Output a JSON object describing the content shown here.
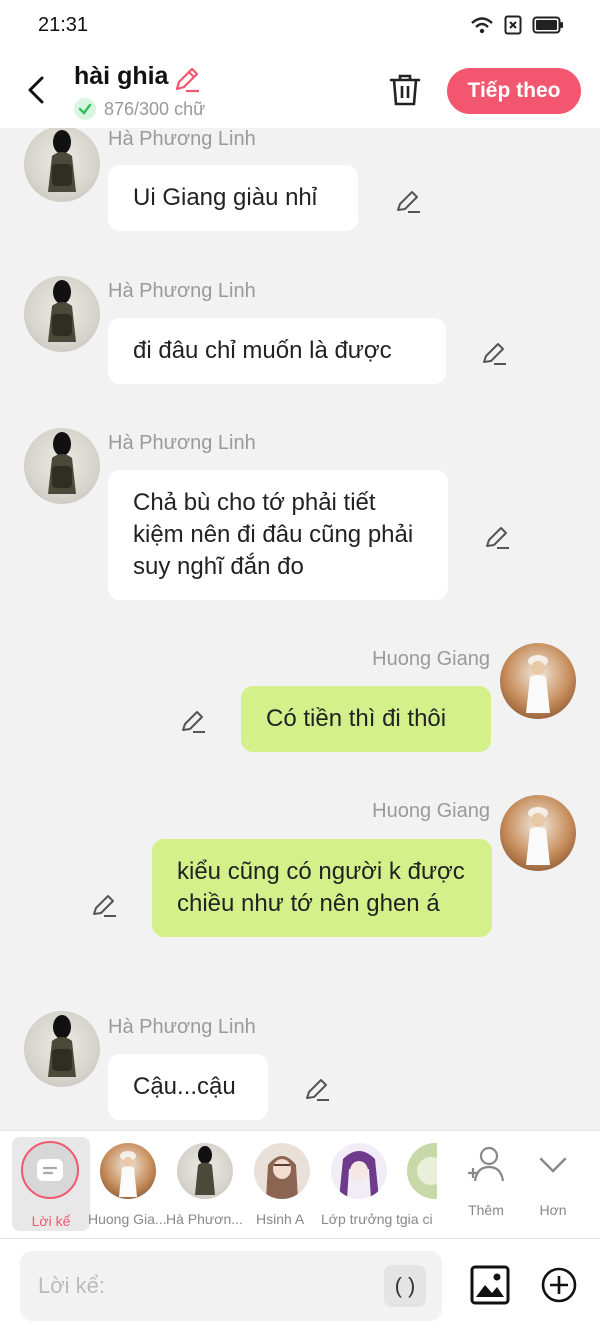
{
  "status": {
    "time": "21:31"
  },
  "header": {
    "title": "hài ghia",
    "char_count": "876/300 chữ",
    "next_label": "Tiếp theo",
    "accent": "#f3566f"
  },
  "messages": [
    {
      "sender": "Hà Phương Linh",
      "text": "Ui Giang giàu nhỉ",
      "side": "left"
    },
    {
      "sender": "Hà Phương Linh",
      "text": "đi đâu chỉ muốn là được",
      "side": "left"
    },
    {
      "sender": "Hà Phương Linh",
      "text": "Chả bù cho tớ phải tiết kiệm nên đi đâu cũng phải suy nghĩ đắn đo",
      "side": "left"
    },
    {
      "sender": "Huong Giang",
      "text": "Có tiền thì đi thôi",
      "side": "right"
    },
    {
      "sender": "Huong Giang",
      "text": "kiểu cũng có người k được chiều như tớ nên ghen á",
      "side": "right"
    },
    {
      "sender": "Hà Phương Linh",
      "text": "Cậu...cậu",
      "side": "left"
    }
  ],
  "characters": {
    "narration_label": "Lời kể",
    "items": [
      {
        "label": "Huong Gia..."
      },
      {
        "label": "Hà Phươn..."
      },
      {
        "label": "Hsinh A"
      },
      {
        "label": "Lớp trưởng"
      },
      {
        "label": "tgia ci"
      }
    ],
    "more_label": "Thêm",
    "less_label": "Hơn"
  },
  "input": {
    "placeholder": "Lời kể:",
    "paren_label": "( )"
  },
  "colors": {
    "bubble_right": "#d3f08a",
    "bubble_left": "#ffffff",
    "background": "#f2f2f2"
  }
}
